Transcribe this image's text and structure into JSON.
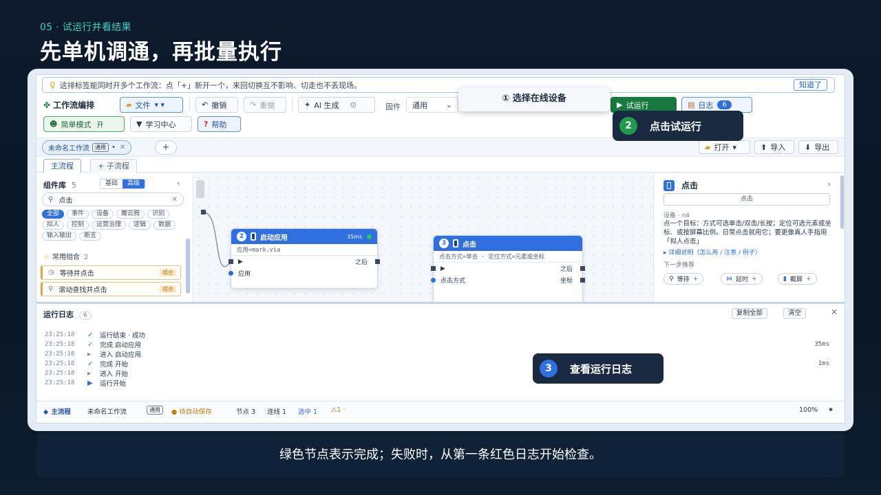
{
  "slide": {
    "tag": "05 · 试运行并看结果",
    "title": "先单机调通，再批量执行",
    "caption": "绿色节点表示完成；失败时，从第一条红色日志开始检查。"
  },
  "tip": {
    "text": "这排标签能同时开多个工作流：点「+」新开一个，来回切换互不影响、切走也不丢现场。",
    "dismiss": "知道了"
  },
  "toolbar": {
    "brand": "工作流编排",
    "file": "文件",
    "undo": "撤销",
    "redo": "重做",
    "ai": "AI 生成",
    "firmware_label": "固件",
    "firmware_value": "通用",
    "run": "试运行",
    "log": "日志",
    "log_count": "6",
    "simple_mode": "简单模式",
    "simple_mode_state": "开",
    "learn": "学习中心",
    "help": "帮助",
    "open": "打开",
    "import": "导入",
    "export": "导出"
  },
  "workflow_tab": {
    "name": "未命名工作流",
    "badge": "通用",
    "add": "+"
  },
  "subtabs": [
    "主流程",
    "+ 子流程"
  ],
  "library": {
    "title": "组件库",
    "count": "5",
    "seg_basic": "基础",
    "seg_advanced": "高级",
    "search_value": "点击",
    "chips": [
      "全部",
      "事件",
      "设备",
      "魔云腾",
      "识别",
      "拟人",
      "控制",
      "运营治理",
      "逻辑",
      "数据",
      "输入输出",
      "断言"
    ],
    "combo_title": "常用组合",
    "combo_count": "2",
    "combos": [
      {
        "label": "等待并点击",
        "tag": "组合"
      },
      {
        "label": "滚动查找并点击",
        "tag": "组合"
      }
    ]
  },
  "nodes": [
    {
      "num": "2",
      "title": "启动应用",
      "ms": "35ms",
      "sub": "应用=mark.via",
      "out_label": "之后",
      "param": "应用"
    },
    {
      "num": "3",
      "title": "点击",
      "sub": "点击方式=单击 · 定位方式=元素或坐标",
      "out_label": "之后",
      "param": "点击方式",
      "param_right": "坐标"
    }
  ],
  "props": {
    "title": "点击",
    "name_value": "点击",
    "device_id": "设备 · n4",
    "description": "点一个目标：方式可选单击/双击/长按；定位可选元素或坐标、或按屏幕比例。日常点击就用它；要更像真人手指用「拟人点击」",
    "detail_link": "▸ 详细说明（怎么用 / 注意 / 例子）",
    "next_title": "下一步推荐",
    "next": [
      {
        "label": "等待"
      },
      {
        "label": "延时"
      },
      {
        "label": "截屏"
      }
    ]
  },
  "log": {
    "title": "运行日志",
    "count": "6",
    "copy_all": "复制全部",
    "clear": "清空",
    "lines": [
      {
        "time": "23:25:18",
        "kind": "check",
        "text": "运行结束 · 成功",
        "ms": ""
      },
      {
        "time": "23:25:18",
        "kind": "check",
        "text": "完成  启动应用",
        "ms": "35ms"
      },
      {
        "time": "23:25:18",
        "kind": "dot",
        "text": "进入  启动应用",
        "ms": ""
      },
      {
        "time": "23:25:18",
        "kind": "check",
        "text": "完成  开始",
        "ms": "1ms"
      },
      {
        "time": "23:25:18",
        "kind": "dot",
        "text": "进入  开始",
        "ms": ""
      },
      {
        "time": "23:25:18",
        "kind": "arrow",
        "text": "运行开始",
        "ms": ""
      }
    ]
  },
  "status": {
    "main": "主流程",
    "name": "未命名工作流",
    "badge": "通用",
    "autosave": "● 待自动保存",
    "nodes": "节点 3",
    "links": "连线 1",
    "selected": "选中 1",
    "warn": "⚠1 ·",
    "zoom": "100%"
  },
  "callouts": {
    "c1": "① 选择在线设备",
    "c2_num": "2",
    "c2": "点击试运行",
    "c3_num": "3",
    "c3": "查看运行日志"
  },
  "colors": {
    "accent": "#2f6fe0",
    "run_green": "#167a3f",
    "callout_bg": "#1a2a40",
    "tag_teal": "#2fd4c4"
  }
}
